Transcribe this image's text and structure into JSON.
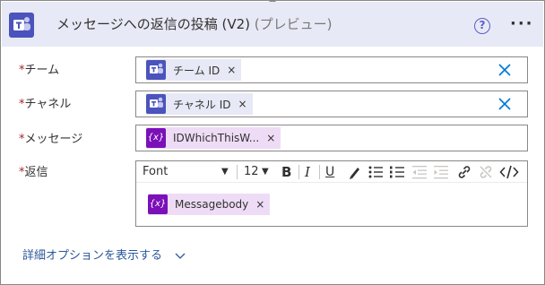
{
  "header": {
    "title": "メッセージへの返信の投稿 (V2)",
    "preview": "(プレビュー)",
    "help": "?",
    "more": "···",
    "app_icon": "teams-icon"
  },
  "fields": [
    {
      "label": "チーム",
      "required": "*",
      "token": "チーム ID",
      "remove": "×",
      "token_icon": "teams-icon"
    },
    {
      "label": "チャネル",
      "required": "*",
      "token": "チャネル ID",
      "remove": "×",
      "token_icon": "teams-icon"
    },
    {
      "label": "メッセージ",
      "required": "*",
      "token": "IDWhichThisW...",
      "remove": "×",
      "token_icon": "expression-icon"
    },
    {
      "label": "返信",
      "required": "*"
    }
  ],
  "expr_glyph": "{x}",
  "editor": {
    "font": "Font",
    "size": "12",
    "bold": "B",
    "italic": "I",
    "underline": "U",
    "token": "Messagebody",
    "remove": "×"
  },
  "advanced_link": "詳細オプションを表示する",
  "colors": {
    "teams_purple": "#4b53bc",
    "expression_purple": "#7b10b8",
    "link_blue": "#2b579a",
    "required_red": "#a4262c"
  }
}
